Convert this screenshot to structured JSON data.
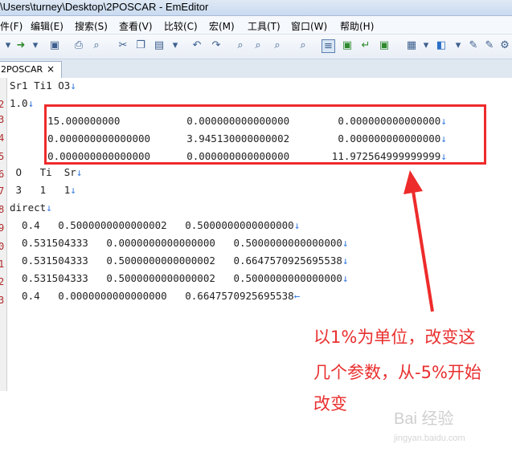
{
  "window": {
    "title": "\\Users\\turney\\Desktop\\2POSCAR - EmEditor"
  },
  "menu": [
    "件(F)",
    "编辑(E)",
    "搜索(S)",
    "查看(V)",
    "比较(C)",
    "宏(M)",
    "工具(T)",
    "窗口(W)",
    "帮助(H)"
  ],
  "tab": {
    "label": "2POSCAR",
    "close": "×"
  },
  "gutter": [
    "2",
    "3",
    "4",
    "5",
    "6",
    "7",
    "8",
    "9",
    "0",
    "1",
    "2",
    "3"
  ],
  "lines": [
    {
      "text": "Sr1 Ti1 O3",
      "eol": "↓"
    },
    {
      "text": "1.0",
      "eol": "↓"
    },
    {
      "text": "    15.000000000           0.000000000000000        0.000000000000000",
      "eol": "↓"
    },
    {
      "text": "    0.000000000000000      3.945130000000002        0.000000000000000",
      "eol": "↓"
    },
    {
      "text": "    0.000000000000000      0.000000000000000       11.972564999999999",
      "eol": "↓"
    },
    {
      "text": " O   Ti  Sr",
      "eol": "↓"
    },
    {
      "text": " 3   1   1",
      "eol": "↓"
    },
    {
      "text": "direct",
      "eol": "↓"
    },
    {
      "text": "  0.4   0.5000000000000002   0.5000000000000000",
      "eol": "↓"
    },
    {
      "text": "  0.531504333   0.0000000000000000   0.5000000000000000",
      "eol": "↓"
    },
    {
      "text": "  0.531504333   0.5000000000000002   0.6647570925695538",
      "eol": "↓"
    },
    {
      "text": "  0.531504333   0.5000000000000002   0.5000000000000000",
      "eol": "↓"
    },
    {
      "text": "  0.4   0.0000000000000000   0.6647570925695538",
      "eol": "←"
    }
  ],
  "annotation": [
    "以1%为单位，改变这",
    "几个参数，从-5%开始",
    "改变"
  ],
  "watermark": {
    "brand": "Bai 经验",
    "url": "jingyan.baidu.com"
  },
  "colors": {
    "highlight": "#ee2b2b",
    "eol": "#3b7de0"
  }
}
